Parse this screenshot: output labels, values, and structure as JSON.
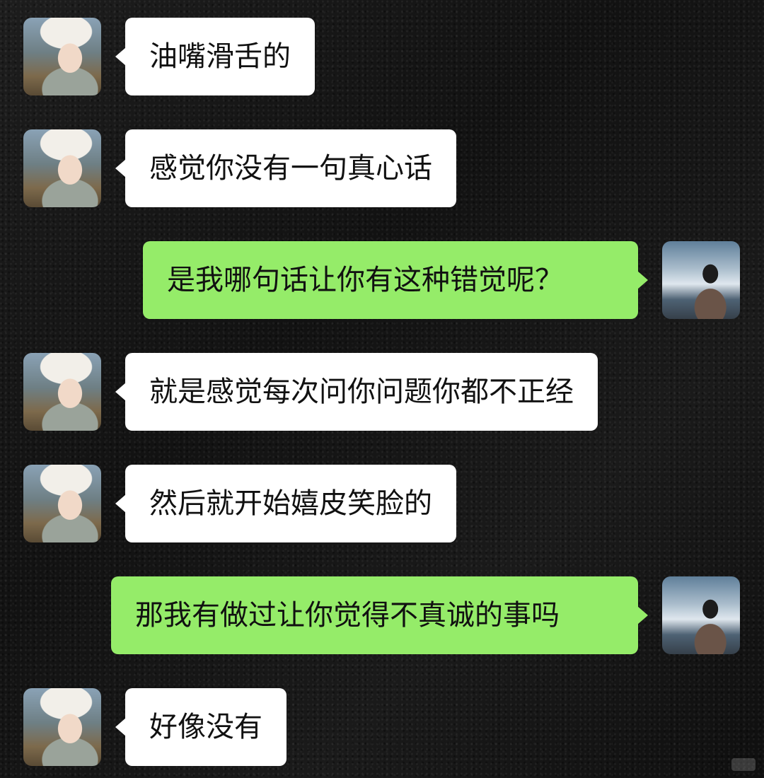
{
  "messages": [
    {
      "sender": "her",
      "avatar": "girl-avatar",
      "text": "油嘴滑舌的"
    },
    {
      "sender": "her",
      "avatar": "girl-avatar",
      "text": "感觉你没有一句真心话"
    },
    {
      "sender": "me",
      "avatar": "boy-avatar",
      "text": "是我哪句话让你有这种错觉呢？"
    },
    {
      "sender": "her",
      "avatar": "girl-avatar",
      "text": "就是感觉每次问你问题你都不正经"
    },
    {
      "sender": "her",
      "avatar": "girl-avatar",
      "text": "然后就开始嬉皮笑脸的"
    },
    {
      "sender": "me",
      "avatar": "boy-avatar",
      "text": "那我有做过让你觉得不真诚的事吗"
    },
    {
      "sender": "her",
      "avatar": "girl-avatar",
      "text": "好像没有"
    }
  ],
  "colors": {
    "background": "#161616",
    "incoming_bubble": "#ffffff",
    "outgoing_bubble": "#95ec69",
    "message_text": "#111111"
  }
}
